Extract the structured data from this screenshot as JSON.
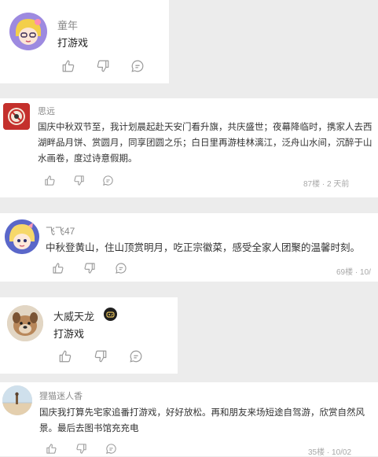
{
  "comments": [
    {
      "username": "童年",
      "content": "打游戏"
    },
    {
      "username": "思远",
      "content": "国庆中秋双节至，我计划晨起赴天安门看升旗，共庆盛世；夜幕降临时，携家人去西湖畔品月饼、赏圆月，同享团圆之乐；白日里再游桂林漓江，泛舟山水间，沉醉于山水画卷，度过诗意假期。",
      "floor": "87楼",
      "time": "2 天前",
      "dot": "·"
    },
    {
      "username": "飞飞47",
      "content": "中秋登黄山，住山顶赏明月，吃正宗徽菜，感受全家人团聚的温馨时刻。",
      "floor": "69楼",
      "time": "10/",
      "dot": "·"
    },
    {
      "username": "大威天龙",
      "content": "打游戏"
    },
    {
      "username": "狸猫迷人香",
      "content": "国庆我打算先宅家追番打游戏，好好放松。再和朋友来场短途自驾游，欣赏自然风景。最后去图书馆充充电",
      "floor": "35楼",
      "time": "10/02",
      "dot": "·"
    }
  ],
  "icons": {
    "like": "thumbs-up-icon",
    "dislike": "thumbs-down-icon",
    "reply": "comment-bubble-icon",
    "badge": "game-controller-badge-icon"
  },
  "colors": {
    "page_bg": "#ececec",
    "card_bg": "#ffffff",
    "username": "#8a8a8a",
    "text": "#222222",
    "meta": "#a8a8a8",
    "icon": "#9a9a9a"
  }
}
